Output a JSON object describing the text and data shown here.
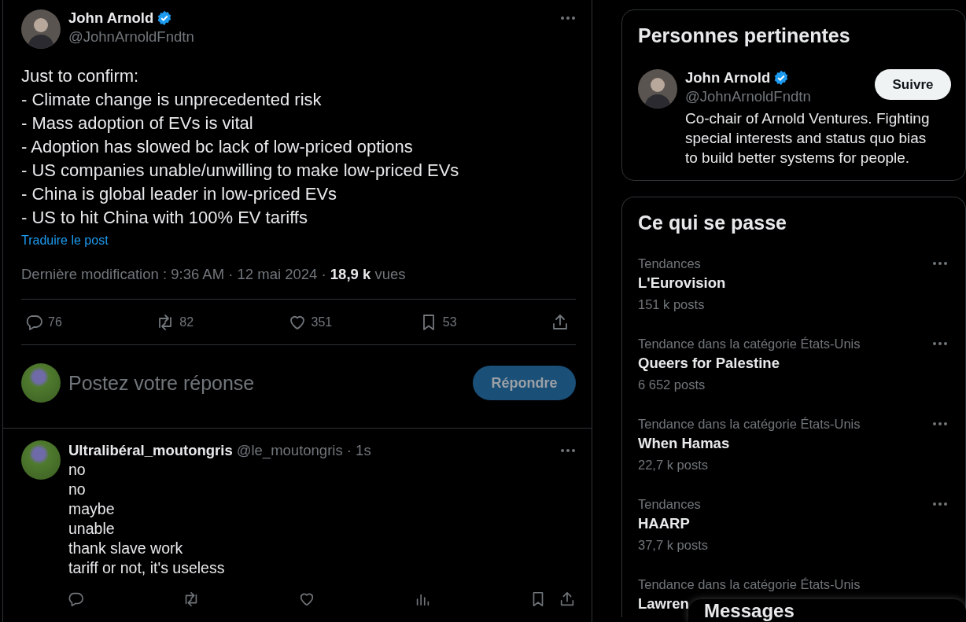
{
  "post": {
    "author": {
      "name": "John Arnold",
      "handle": "@JohnArnoldFndtn",
      "verified": true
    },
    "text_lines": [
      "Just to confirm:",
      "- Climate change is unprecedented risk",
      "- Mass adoption of EVs is vital",
      "- Adoption has slowed bc lack of low-priced options",
      "- US companies unable/unwilling to make low-priced EVs",
      "- China is global leader in low-priced EVs",
      "- US to hit China with 100% EV tariffs"
    ],
    "translate_link": "Traduire le post",
    "meta": "Dernière modification : 9:36 AM · 12 mai 2024 · **18,9 k** vues",
    "actions": [
      {
        "kind": "reply",
        "count": "76"
      },
      {
        "kind": "repost",
        "count": "82"
      },
      {
        "kind": "like",
        "count": "351"
      },
      {
        "kind": "bookmark",
        "count": "53"
      },
      {
        "kind": "share"
      }
    ],
    "composer": {
      "placeholder": "Postez votre réponse",
      "button": "Répondre",
      "disabled": true
    }
  },
  "replies": [
    {
      "name": "Ultralibéral_moutongris",
      "meta": "@le_moutongris · 1s",
      "lines": [
        "no",
        "no",
        "maybe",
        "unable",
        "thank slave work",
        "tariff or not, it's useless"
      ],
      "actions": [
        {
          "kind": "reply"
        },
        {
          "kind": "repost"
        },
        {
          "kind": "like"
        },
        {
          "kind": "views"
        },
        {
          "kind": "bookmark"
        },
        {
          "kind": "share"
        }
      ]
    }
  ],
  "sidebar": {
    "relevant_people": {
      "title": "Personnes pertinentes",
      "people": [
        {
          "name": "John Arnold",
          "handle": "@JohnArnoldFndtn",
          "verified": true,
          "bio": "Co-chair of Arnold Ventures. Fighting special interests and status quo bias to build better systems for people.",
          "follow_button": "Suivre"
        }
      ]
    },
    "trends": {
      "title": "Ce qui se passe",
      "items": [
        {
          "category": "Tendances",
          "name": "L'Eurovision",
          "count": "151 k posts"
        },
        {
          "category": "Tendance dans la catégorie États-Unis",
          "name": "Queers for Palestine",
          "count": "6 652 posts"
        },
        {
          "category": "Tendance dans la catégorie États-Unis",
          "name": "When Hamas",
          "count": "22,7 k posts"
        },
        {
          "category": "Tendances",
          "name": "HAARP",
          "count": "37,7 k posts"
        },
        {
          "category": "Tendance dans la catégorie États-Unis",
          "name": "Lawren"
        }
      ]
    },
    "messages_drawer": {
      "title": "Messages"
    }
  }
}
